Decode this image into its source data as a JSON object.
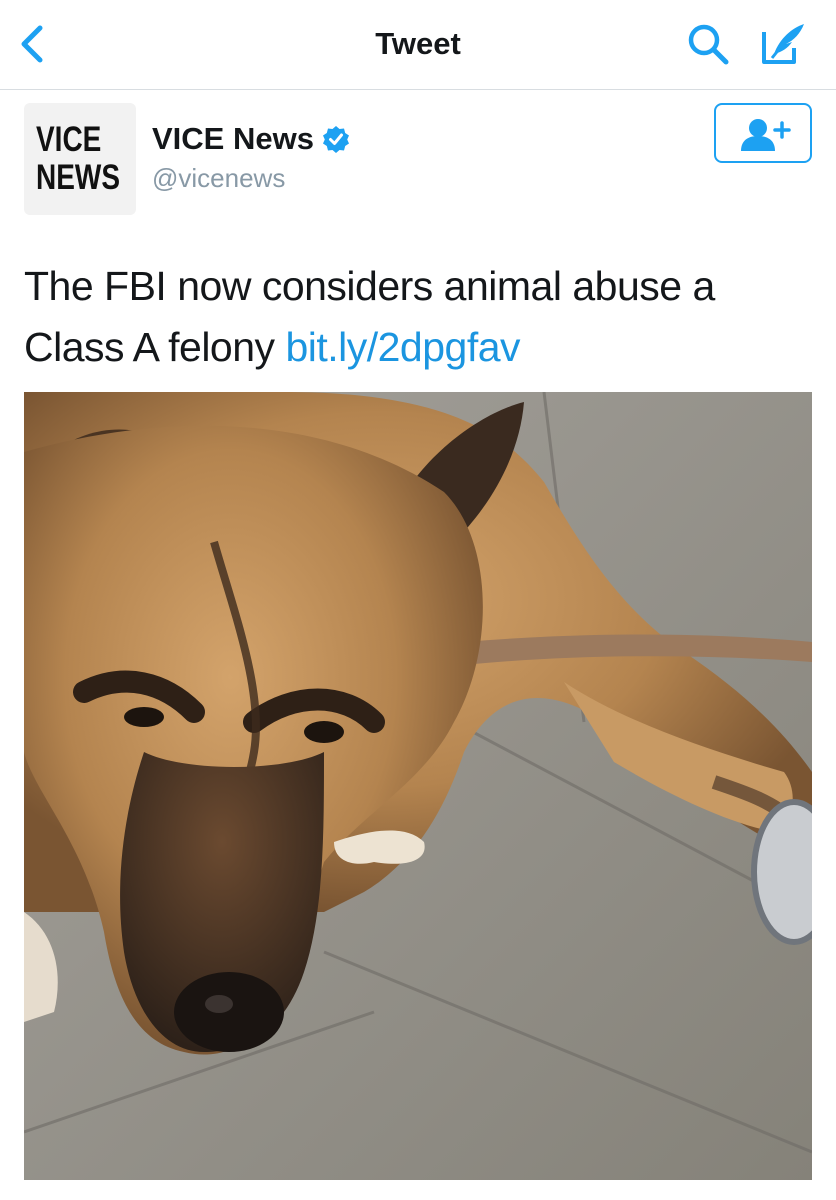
{
  "nav": {
    "title": "Tweet",
    "back_icon": "chevron-left-icon",
    "search_icon": "search-icon",
    "compose_icon": "compose-tweet-icon",
    "accent": "#1da1f2"
  },
  "author": {
    "avatar_text": "VICE NEWS",
    "display_name": "VICE News",
    "verified": true,
    "handle": "@vicenews",
    "follow_icon": "follow-user-icon"
  },
  "tweet": {
    "text": "The FBI now considers animal abuse a Class A felony ",
    "link": "bit.ly/2dpgfav",
    "link_color": "#1b95e0"
  },
  "media": {
    "description_icon": "photo-dog",
    "colors": {
      "fur": "#b88a55",
      "pavement": "#8e8c86",
      "leash": "#9c7a5e"
    }
  }
}
